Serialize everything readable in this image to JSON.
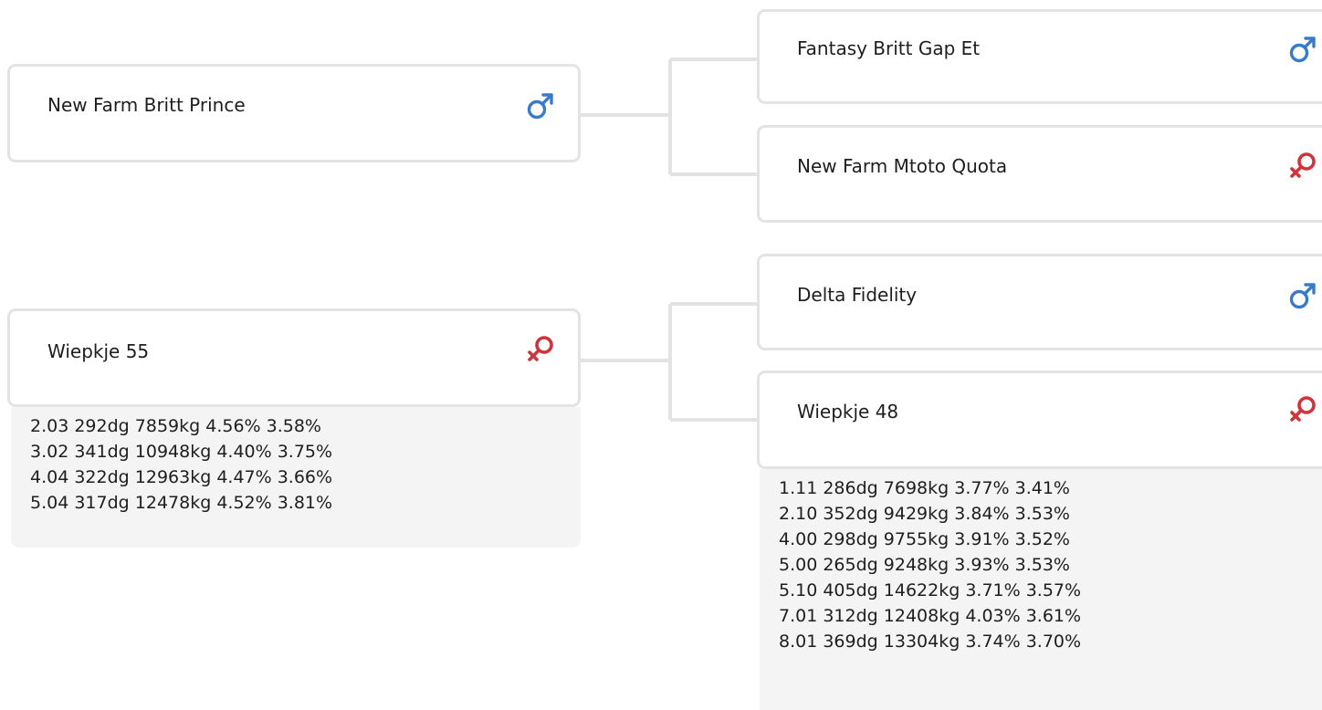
{
  "parents": [
    {
      "name": "New Farm Britt Prince",
      "sex": "male",
      "sex_icon": "male-icon",
      "lactations": []
    },
    {
      "name": "Wiepkje 55",
      "sex": "female",
      "sex_icon": "female-icon",
      "lactations": [
        "2.03 292dg 7859kg 4.56% 3.58%",
        "3.02 341dg 10948kg 4.40% 3.75%",
        "4.04 322dg 12963kg 4.47% 3.66%",
        "5.04 317dg 12478kg 4.52% 3.81%"
      ]
    }
  ],
  "grandparents": [
    {
      "name": "Fantasy Britt Gap Et",
      "sex": "male",
      "sex_icon": "male-icon",
      "lactations": []
    },
    {
      "name": "New Farm Mtoto Quota",
      "sex": "female",
      "sex_icon": "female-icon",
      "lactations": []
    },
    {
      "name": "Delta Fidelity",
      "sex": "male",
      "sex_icon": "male-icon",
      "lactations": []
    },
    {
      "name": "Wiepkje 48",
      "sex": "female",
      "sex_icon": "female-icon",
      "lactations": [
        "1.11 286dg 7698kg 3.77% 3.41%",
        "2.10 352dg 9429kg 3.84% 3.53%",
        "4.00 298dg 9755kg 3.91% 3.52%",
        "5.00 265dg 9248kg 3.93% 3.53%",
        "5.10 405dg 14622kg 3.71% 3.57%",
        "7.01 312dg 12408kg 4.03% 3.61%",
        "8.01 369dg 13304kg 3.74% 3.70%"
      ]
    }
  ],
  "colors": {
    "male": "#3a7bc8",
    "female": "#d0343a",
    "card_border": "#e3e3e3",
    "connector": "#e3e3e3",
    "lactation_bg": "#f4f4f4"
  }
}
